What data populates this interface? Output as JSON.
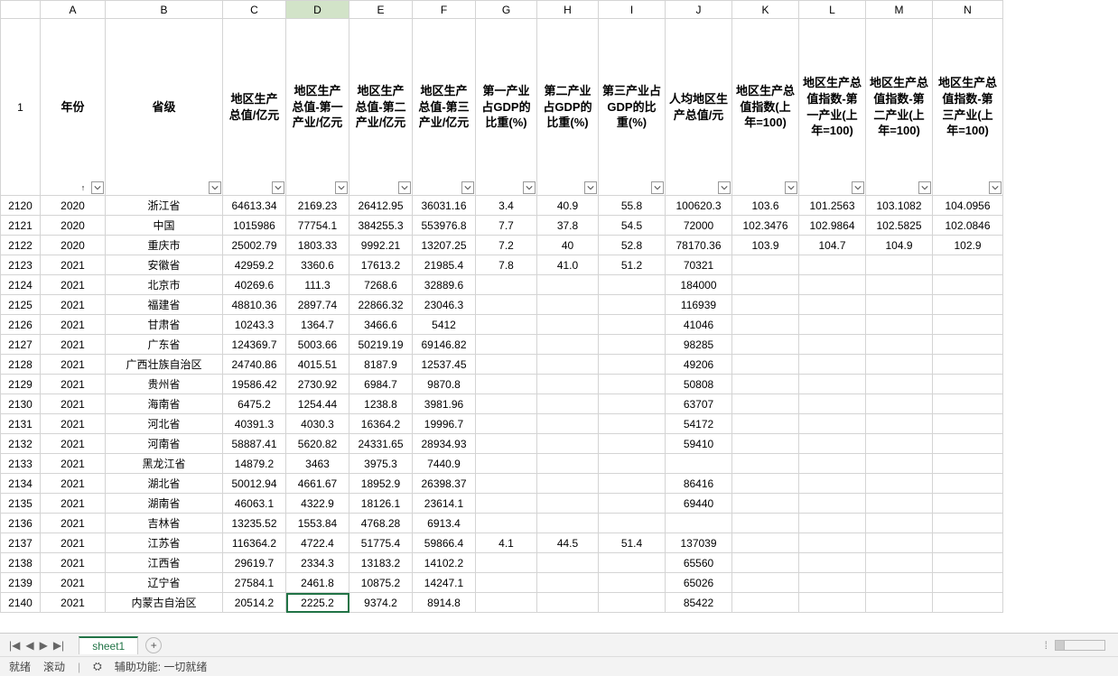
{
  "columns": [
    "A",
    "B",
    "C",
    "D",
    "E",
    "F",
    "G",
    "H",
    "I",
    "J",
    "K",
    "L",
    "M",
    "N"
  ],
  "activeCol": "D",
  "headers": {
    "A": "年份",
    "B": "省级",
    "C": "地区生产总值/亿元",
    "D": "地区生产总值-第一产业/亿元",
    "E": "地区生产总值-第二产业/亿元",
    "F": "地区生产总值-第三产业/亿元",
    "G": "第一产业占GDP的比重(%)",
    "H": "第二产业占GDP的比重(%)",
    "I": "第三产业占GDP的比重(%)",
    "J": "人均地区生产总值/元",
    "K": "地区生产总值指数(上年=100)",
    "L": "地区生产总值指数-第一产业(上年=100)",
    "M": "地区生产总值指数-第二产业(上年=100)",
    "N": "地区生产总值指数-第三产业(上年=100)"
  },
  "headerRowNum": "1",
  "sortCol": "A",
  "rows": [
    {
      "n": "2120",
      "c": [
        "2020",
        "浙江省",
        "64613.34",
        "2169.23",
        "26412.95",
        "36031.16",
        "3.4",
        "40.9",
        "55.8",
        "100620.3",
        "103.6",
        "101.2563",
        "103.1082",
        "104.0956"
      ]
    },
    {
      "n": "2121",
      "c": [
        "2020",
        "中国",
        "1015986",
        "77754.1",
        "384255.3",
        "553976.8",
        "7.7",
        "37.8",
        "54.5",
        "72000",
        "102.3476",
        "102.9864",
        "102.5825",
        "102.0846"
      ]
    },
    {
      "n": "2122",
      "c": [
        "2020",
        "重庆市",
        "25002.79",
        "1803.33",
        "9992.21",
        "13207.25",
        "7.2",
        "40",
        "52.8",
        "78170.36",
        "103.9",
        "104.7",
        "104.9",
        "102.9"
      ]
    },
    {
      "n": "2123",
      "c": [
        "2021",
        "安徽省",
        "42959.2",
        "3360.6",
        "17613.2",
        "21985.4",
        "7.8",
        "41.0",
        "51.2",
        "70321",
        "",
        "",
        "",
        ""
      ]
    },
    {
      "n": "2124",
      "c": [
        "2021",
        "北京市",
        "40269.6",
        "111.3",
        "7268.6",
        "32889.6",
        "",
        "",
        "",
        "184000",
        "",
        "",
        "",
        ""
      ]
    },
    {
      "n": "2125",
      "c": [
        "2021",
        "福建省",
        "48810.36",
        "2897.74",
        "22866.32",
        "23046.3",
        "",
        "",
        "",
        "116939",
        "",
        "",
        "",
        ""
      ]
    },
    {
      "n": "2126",
      "c": [
        "2021",
        "甘肃省",
        "10243.3",
        "1364.7",
        "3466.6",
        "5412",
        "",
        "",
        "",
        "41046",
        "",
        "",
        "",
        ""
      ]
    },
    {
      "n": "2127",
      "c": [
        "2021",
        "广东省",
        "124369.7",
        "5003.66",
        "50219.19",
        "69146.82",
        "",
        "",
        "",
        "98285",
        "",
        "",
        "",
        ""
      ]
    },
    {
      "n": "2128",
      "c": [
        "2021",
        "广西壮族自治区",
        "24740.86",
        "4015.51",
        "8187.9",
        "12537.45",
        "",
        "",
        "",
        "49206",
        "",
        "",
        "",
        ""
      ]
    },
    {
      "n": "2129",
      "c": [
        "2021",
        "贵州省",
        "19586.42",
        "2730.92",
        "6984.7",
        "9870.8",
        "",
        "",
        "",
        "50808",
        "",
        "",
        "",
        ""
      ]
    },
    {
      "n": "2130",
      "c": [
        "2021",
        "海南省",
        "6475.2",
        "1254.44",
        "1238.8",
        "3981.96",
        "",
        "",
        "",
        "63707",
        "",
        "",
        "",
        ""
      ]
    },
    {
      "n": "2131",
      "c": [
        "2021",
        "河北省",
        "40391.3",
        "4030.3",
        "16364.2",
        "19996.7",
        "",
        "",
        "",
        "54172",
        "",
        "",
        "",
        ""
      ]
    },
    {
      "n": "2132",
      "c": [
        "2021",
        "河南省",
        "58887.41",
        "5620.82",
        "24331.65",
        "28934.93",
        "",
        "",
        "",
        "59410",
        "",
        "",
        "",
        ""
      ]
    },
    {
      "n": "2133",
      "c": [
        "2021",
        "黑龙江省",
        "14879.2",
        "3463",
        "3975.3",
        "7440.9",
        "",
        "",
        "",
        "",
        "",
        "",
        "",
        ""
      ]
    },
    {
      "n": "2134",
      "c": [
        "2021",
        "湖北省",
        "50012.94",
        "4661.67",
        "18952.9",
        "26398.37",
        "",
        "",
        "",
        "86416",
        "",
        "",
        "",
        ""
      ]
    },
    {
      "n": "2135",
      "c": [
        "2021",
        "湖南省",
        "46063.1",
        "4322.9",
        "18126.1",
        "23614.1",
        "",
        "",
        "",
        "69440",
        "",
        "",
        "",
        ""
      ]
    },
    {
      "n": "2136",
      "c": [
        "2021",
        "吉林省",
        "13235.52",
        "1553.84",
        "4768.28",
        "6913.4",
        "",
        "",
        "",
        "",
        "",
        "",
        "",
        ""
      ]
    },
    {
      "n": "2137",
      "c": [
        "2021",
        "江苏省",
        "116364.2",
        "4722.4",
        "51775.4",
        "59866.4",
        "4.1",
        "44.5",
        "51.4",
        "137039",
        "",
        "",
        "",
        ""
      ]
    },
    {
      "n": "2138",
      "c": [
        "2021",
        "江西省",
        "29619.7",
        "2334.3",
        "13183.2",
        "14102.2",
        "",
        "",
        "",
        "65560",
        "",
        "",
        "",
        ""
      ]
    },
    {
      "n": "2139",
      "c": [
        "2021",
        "辽宁省",
        "27584.1",
        "2461.8",
        "10875.2",
        "14247.1",
        "",
        "",
        "",
        "65026",
        "",
        "",
        "",
        ""
      ]
    },
    {
      "n": "2140",
      "c": [
        "2021",
        "内蒙古自治区",
        "20514.2",
        "2225.2",
        "9374.2",
        "8914.8",
        "",
        "",
        "",
        "85422",
        "",
        "",
        "",
        ""
      ]
    }
  ],
  "selectedCell": {
    "row": "2140",
    "col": "D"
  },
  "tabs": {
    "active": "sheet1",
    "add": "+"
  },
  "nav": {
    "first": "|◀",
    "prev": "◀",
    "next": "▶",
    "last": "▶|"
  },
  "status": {
    "ready": "就绪",
    "scroll": "滚动",
    "access_icon": "⛭",
    "access": "辅助功能: 一切就绪"
  },
  "icons": {
    "filter_down": "▾",
    "sort_asc": "↑"
  }
}
